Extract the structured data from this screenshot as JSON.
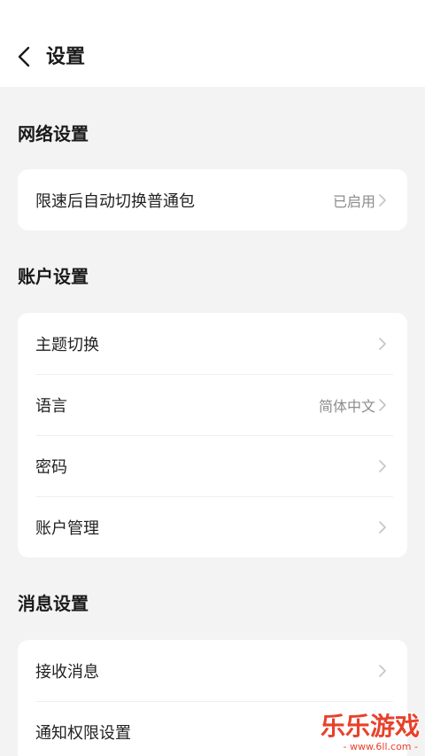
{
  "header": {
    "title": "设置",
    "back_icon": "chevron-left-icon"
  },
  "sections": [
    {
      "title": "网络设置",
      "rows": [
        {
          "label": "限速后自动切换普通包",
          "value": "已启用"
        }
      ]
    },
    {
      "title": "账户设置",
      "rows": [
        {
          "label": "主题切换",
          "value": ""
        },
        {
          "label": "语言",
          "value": "简体中文"
        },
        {
          "label": "密码",
          "value": ""
        },
        {
          "label": "账户管理",
          "value": ""
        }
      ]
    },
    {
      "title": "消息设置",
      "rows": [
        {
          "label": "接收消息",
          "value": ""
        },
        {
          "label": "通知权限设置",
          "value": ""
        }
      ]
    }
  ],
  "watermark": {
    "title": "乐乐游戏",
    "url": "- www.6ll.com -"
  },
  "colors": {
    "background": "#f3f3f3",
    "card": "#ffffff",
    "text": "#222222",
    "secondary_text": "#8c8c8c",
    "chevron": "#c4c4c4",
    "watermark": "#e8412b"
  }
}
